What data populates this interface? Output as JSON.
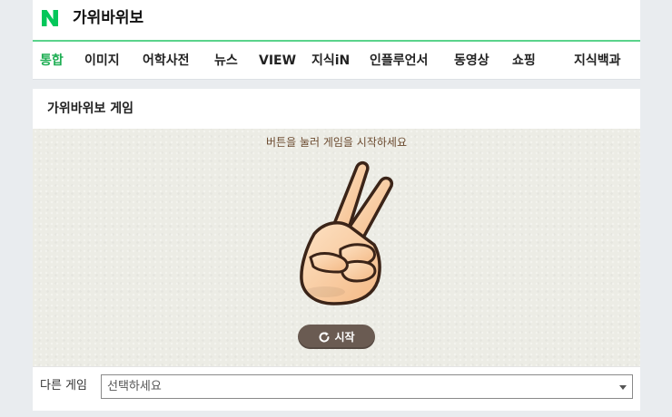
{
  "header": {
    "logo_letter": "N",
    "query": "가위바위보",
    "brand_color": "#03c75a",
    "tabs": [
      {
        "label": "통합",
        "active": true
      },
      {
        "label": "이미지",
        "active": false
      },
      {
        "label": "어학사전",
        "active": false
      },
      {
        "label": "뉴스",
        "active": false
      },
      {
        "label": "VIEW",
        "active": false
      },
      {
        "label": "지식iN",
        "active": false
      },
      {
        "label": "인플루언서",
        "active": false
      },
      {
        "label": "동영상",
        "active": false
      },
      {
        "label": "쇼핑",
        "active": false
      },
      {
        "label": "지식백과",
        "active": false
      }
    ]
  },
  "game": {
    "title": "가위바위보 게임",
    "instruction": "버튼을 눌러 게임을 시작하세요",
    "hand_icon": "scissors-hand-icon",
    "start_label": "시작",
    "start_icon": "refresh-icon"
  },
  "other_games": {
    "label": "다른 게임",
    "selected": "선택하세요"
  }
}
